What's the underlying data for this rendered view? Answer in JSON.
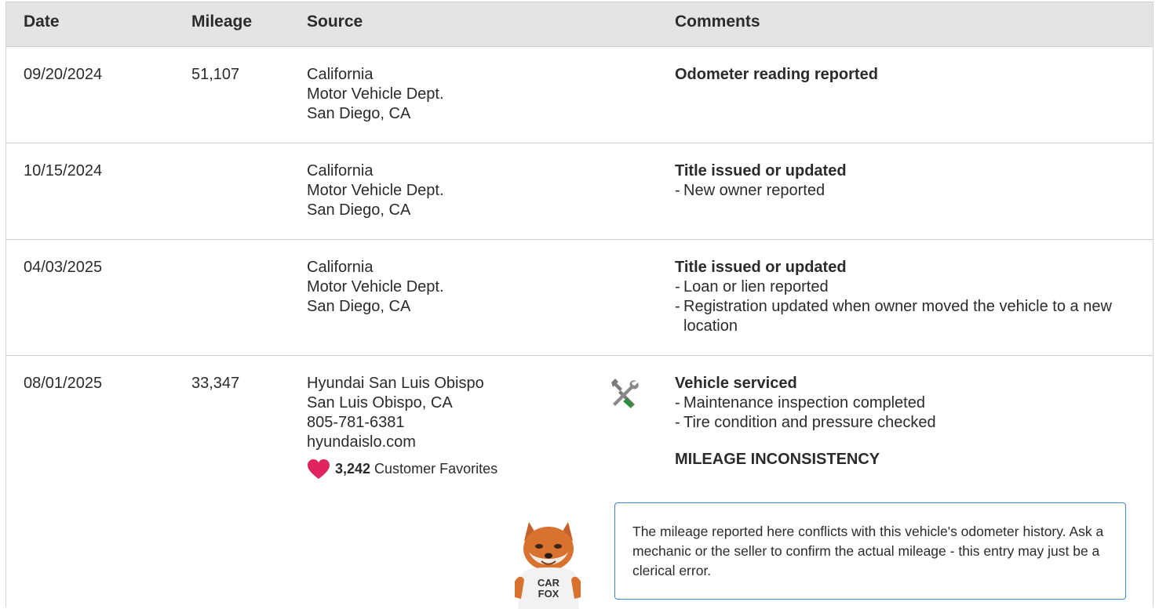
{
  "columns": {
    "date": "Date",
    "mileage": "Mileage",
    "source": "Source",
    "comments": "Comments"
  },
  "rows": [
    {
      "date": "09/20/2024",
      "mileage": "51,107",
      "source": [
        "California",
        "Motor Vehicle Dept.",
        "San Diego, CA"
      ],
      "comment_title": "Odometer reading reported",
      "bullets": []
    },
    {
      "date": "10/15/2024",
      "mileage": "",
      "source": [
        "California",
        "Motor Vehicle Dept.",
        "San Diego, CA"
      ],
      "comment_title": "Title issued or updated",
      "bullets": [
        "New owner reported"
      ]
    },
    {
      "date": "04/03/2025",
      "mileage": "",
      "source": [
        "California",
        "Motor Vehicle Dept.",
        "San Diego, CA"
      ],
      "comment_title": "Title issued or updated",
      "bullets": [
        "Loan or lien reported",
        "Registration updated when owner moved the vehicle to a new location"
      ]
    },
    {
      "date": "08/01/2025",
      "mileage": "33,347",
      "source": [
        "Hyundai San Luis Obispo",
        "San Luis Obispo, CA",
        "805-781-6381",
        "hyundaislo.com"
      ],
      "favorites_count": "3,242",
      "favorites_label": "Customer Favorites",
      "comment_title": "Vehicle serviced",
      "bullets": [
        "Maintenance inspection completed",
        "Tire condition and pressure checked"
      ],
      "alert_title": "MILEAGE INCONSISTENCY",
      "note": "The mileage reported here conflicts with this vehicle's odometer history. Ask a mechanic or the seller to confirm the actual mileage - this entry may just be a clerical error.",
      "service_icon": "wrench-screwdriver-icon",
      "mascot_shirt": "CAR FOX"
    }
  ],
  "colors": {
    "header_bg": "#e4e4e4",
    "heart": "#e0245e",
    "note_border": "#3b86c9",
    "tool_green": "#2e8b3a"
  }
}
